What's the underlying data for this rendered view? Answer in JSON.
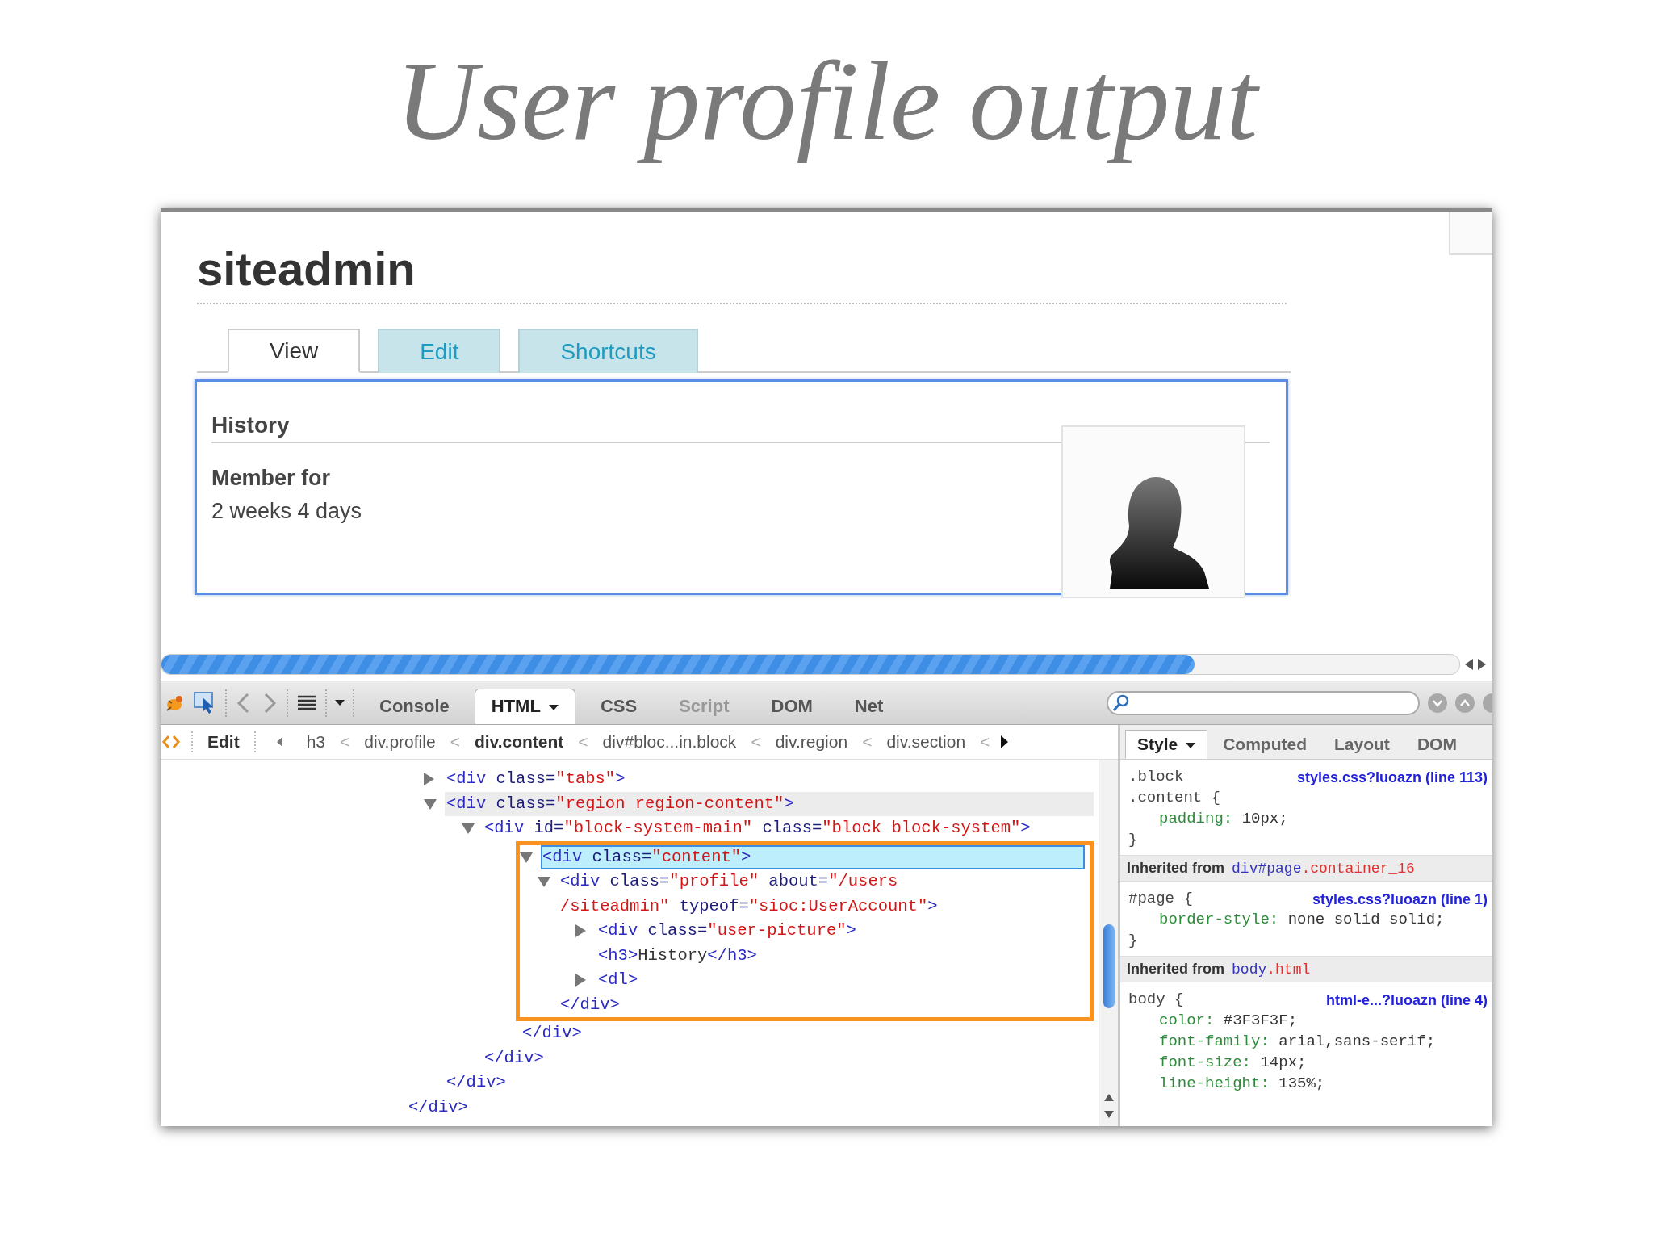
{
  "slide_title": "User profile output",
  "page": {
    "heading": "siteadmin",
    "tabs": [
      {
        "label": "View",
        "selected": true
      },
      {
        "label": "Edit",
        "selected": false
      },
      {
        "label": "Shortcuts",
        "selected": false
      }
    ],
    "section_title": "History",
    "field_label": "Member for",
    "field_value": "2 weeks 4 days"
  },
  "devtools": {
    "panel_tabs": [
      {
        "label": "Console",
        "selected": false,
        "disabled": false,
        "dropdown": false
      },
      {
        "label": "HTML",
        "selected": true,
        "disabled": false,
        "dropdown": true
      },
      {
        "label": "CSS",
        "selected": false,
        "disabled": false,
        "dropdown": false
      },
      {
        "label": "Script",
        "selected": false,
        "disabled": true,
        "dropdown": false
      },
      {
        "label": "DOM",
        "selected": false,
        "disabled": false,
        "dropdown": false
      },
      {
        "label": "Net",
        "selected": false,
        "disabled": false,
        "dropdown": false
      }
    ],
    "edit_button": "Edit",
    "breadcrumb": [
      {
        "label": "h3",
        "selected": false,
        "separator": "<"
      },
      {
        "label": "div.profile",
        "selected": false,
        "separator": "<"
      },
      {
        "label": "div.content",
        "selected": true,
        "separator": "<"
      },
      {
        "label": "div#bloc...in.block",
        "selected": false,
        "separator": "<"
      },
      {
        "label": "div.region",
        "selected": false,
        "separator": "<"
      },
      {
        "label": "div.section",
        "selected": false,
        "separator": "<"
      }
    ],
    "html_tree": {
      "close": "</div>",
      "children": [
        {
          "kind": "element",
          "open": "<div class=\"tabs\">",
          "expanded": false,
          "selected": false,
          "hovered": false,
          "callout": false
        },
        {
          "kind": "element",
          "open": "<div class=\"region region-content\">",
          "expanded": true,
          "selected": false,
          "hovered": true,
          "callout": false,
          "close": "</div>",
          "children": [
            {
              "kind": "element",
              "open": "<div id=\"block-system-main\" class=\"block block-system\">",
              "expanded": true,
              "selected": false,
              "hovered": false,
              "callout": false,
              "close": "</div>",
              "children": [
                {
                  "kind": "element",
                  "open": "<div class=\"content\">",
                  "expanded": true,
                  "selected": true,
                  "hovered": false,
                  "callout": true,
                  "close": "</div>",
                  "children": [
                    {
                      "kind": "element",
                      "open": [
                        "<div class=\"profile\" about=\"/users",
                        "/siteadmin\" typeof=\"sioc:UserAccount\">"
                      ],
                      "expanded": true,
                      "selected": false,
                      "hovered": false,
                      "callout": false,
                      "close": "</div>",
                      "children": [
                        {
                          "kind": "element",
                          "open": "<div class=\"user-picture\">",
                          "expanded": false,
                          "selected": false,
                          "hovered": false,
                          "callout": false
                        },
                        {
                          "kind": "leaf",
                          "open": "<h3>History</h3>",
                          "selected": false,
                          "hovered": false,
                          "callout": false
                        },
                        {
                          "kind": "element",
                          "open": "<dl>",
                          "expanded": false,
                          "selected": false,
                          "hovered": false,
                          "callout": false
                        }
                      ]
                    }
                  ]
                }
              ]
            }
          ]
        }
      ]
    },
    "side_tabs": [
      {
        "label": "Style",
        "selected": true,
        "dropdown": true
      },
      {
        "label": "Computed",
        "selected": false,
        "dropdown": false
      },
      {
        "label": "Layout",
        "selected": false,
        "dropdown": false
      },
      {
        "label": "DOM",
        "selected": false,
        "dropdown": false
      }
    ],
    "style_sections": [
      {
        "kind": "rule",
        "selector": [
          ".block",
          ".content {"
        ],
        "source": "styles.css?luoazn (line 113)",
        "properties": [
          {
            "name": "padding:",
            "value": "10px;"
          }
        ],
        "end": "}"
      },
      {
        "kind": "inherited",
        "label": "Inherited from",
        "element": "div#page",
        "classes": ".container_16"
      },
      {
        "kind": "rule",
        "selector": [
          "#page {"
        ],
        "source": "styles.css?luoazn (line 1)",
        "properties": [
          {
            "name": "border-style:",
            "value": "none solid solid;"
          }
        ],
        "end": "}"
      },
      {
        "kind": "inherited",
        "label": "Inherited from",
        "element": "body",
        "classes": ".html"
      },
      {
        "kind": "rule",
        "selector": [
          "body {"
        ],
        "source": "html-e...?luoazn (line 4)",
        "properties": [
          {
            "name": "color:",
            "value": "#3F3F3F;"
          },
          {
            "name": "font-family:",
            "value": "arial,sans-serif;"
          },
          {
            "name": "font-size:",
            "value": "14px;"
          },
          {
            "name": "line-height:",
            "value": "135%;"
          }
        ]
      }
    ]
  }
}
